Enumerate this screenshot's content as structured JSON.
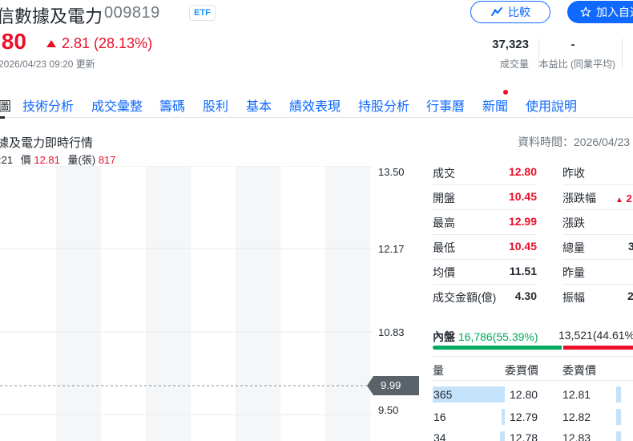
{
  "header": {
    "title": "信數據及電力",
    "code": "009819",
    "badge": "ETF",
    "compare_label": "比較",
    "watch_label": "加入自選",
    "price": ".80",
    "change": "2.81 (28.13%)",
    "updated": "2026/04/23 09:20 更新",
    "stats": [
      {
        "value": "37,323",
        "label": "成交量"
      },
      {
        "value": "-",
        "label": "本益比 (同業平均)"
      }
    ]
  },
  "tabs": [
    "技術分析",
    "成交彙整",
    "籌碼",
    "股利",
    "基本",
    "績效表現",
    "持股分析",
    "行事曆",
    "新聞",
    "使用說明"
  ],
  "section": {
    "title": "據及電力即時行情",
    "data_time": "資料時間：2026/04/23",
    "cur_time": ":21",
    "price_label": "價",
    "price_value": "12.81",
    "volume_label": "量(張)",
    "volume_value": "817"
  },
  "chart": {
    "y_ticks": [
      "13.50",
      "12.17",
      "10.83",
      "9.50"
    ],
    "ref_price": "9.99"
  },
  "quote": {
    "left": [
      {
        "label": "成交",
        "value": "12.80",
        "color": "#eb0f29"
      },
      {
        "label": "開盤",
        "value": "10.45",
        "color": "#eb0f29"
      },
      {
        "label": "最高",
        "value": "12.99",
        "color": "#eb0f29"
      },
      {
        "label": "最低",
        "value": "10.45",
        "color": "#eb0f29"
      },
      {
        "label": "均價",
        "value": "11.51",
        "color": "#232a31"
      },
      {
        "label": "成交金額(億)",
        "value": "4.30",
        "color": "#232a31"
      }
    ],
    "right": [
      {
        "label": "昨收",
        "value": ""
      },
      {
        "label": "漲跌幅",
        "value": "2"
      },
      {
        "label": "漲跌",
        "value": ""
      },
      {
        "label": "總量",
        "value": "3"
      },
      {
        "label": "昨量",
        "value": ""
      },
      {
        "label": "振幅",
        "value": "2"
      }
    ]
  },
  "orderbook": {
    "inner_label": "內盤",
    "inner_value": "16,786",
    "inner_pct": "(55.39%)",
    "outer_value": "13,521",
    "outer_pct": "(44.61%",
    "inner_ratio": 0.5539,
    "headers": [
      "量",
      "委買價",
      "委賣價"
    ],
    "rows": [
      {
        "qty": "365",
        "bid": "12.80",
        "ask": "12.81"
      },
      {
        "qty": "16",
        "bid": "12.79",
        "ask": "12.82"
      },
      {
        "qty": "34",
        "bid": "12.78",
        "ask": "12.83"
      }
    ]
  }
}
